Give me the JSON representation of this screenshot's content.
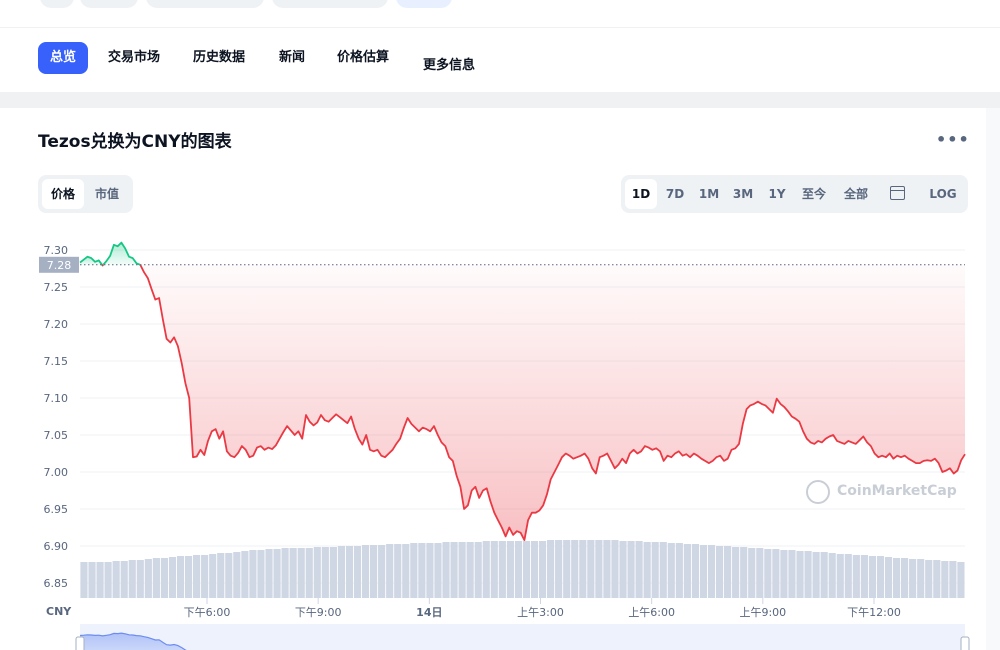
{
  "tabs": [
    {
      "label": "总览",
      "active": true
    },
    {
      "label": "交易市场",
      "active": false
    },
    {
      "label": "历史数据",
      "active": false
    },
    {
      "label": "新闻",
      "active": false
    },
    {
      "label": "价格估算",
      "active": false
    },
    {
      "label": "更多信息",
      "active": false
    }
  ],
  "chart_header": {
    "title": "Tezos兑换为CNY的图表",
    "more_icon": "more-horizontal-icon"
  },
  "metric_toggle": [
    {
      "label": "价格",
      "selected": true
    },
    {
      "label": "市值",
      "selected": false
    }
  ],
  "range_buttons": [
    {
      "label": "1D",
      "selected": true
    },
    {
      "label": "7D",
      "selected": false
    },
    {
      "label": "1M",
      "selected": false
    },
    {
      "label": "3M",
      "selected": false
    },
    {
      "label": "1Y",
      "selected": false
    },
    {
      "label": "至今",
      "selected": false
    },
    {
      "label": "全部",
      "selected": false
    }
  ],
  "calendar_icon": "calendar-icon",
  "log_label": "LOG",
  "watermark": "CoinMarketCap",
  "colors": {
    "accent": "#3861fb",
    "down": "#ea3943",
    "up": "#16c784",
    "volume": "#cfd6e4"
  },
  "chart_data": {
    "type": "line",
    "currency_label": "CNY",
    "y_ticks": [
      "7.30",
      "7.25",
      "7.20",
      "7.15",
      "7.10",
      "7.05",
      "7.00",
      "6.95",
      "6.90",
      "6.85"
    ],
    "ylim": [
      6.85,
      7.3
    ],
    "reference_price": 7.28,
    "reference_label": "7.28",
    "x_ticks": [
      "下午6:00",
      "下午9:00",
      "14日",
      "上午3:00",
      "上午6:00",
      "上午9:00",
      "下午12:00"
    ],
    "series": [
      {
        "values": [
          7.283,
          7.287,
          7.291,
          7.289,
          7.284,
          7.286,
          7.279,
          7.285,
          7.292,
          7.307,
          7.305,
          7.31,
          7.302,
          7.291,
          7.289,
          7.282,
          7.28,
          7.27,
          7.262,
          7.247,
          7.233,
          7.235,
          7.206,
          7.18,
          7.175,
          7.182,
          7.17,
          7.147,
          7.12,
          7.1,
          7.02,
          7.021,
          7.03,
          7.023,
          7.042,
          7.055,
          7.058,
          7.045,
          7.055,
          7.028,
          7.022,
          7.02,
          7.026,
          7.035,
          7.03,
          7.02,
          7.022,
          7.033,
          7.035,
          7.03,
          7.033,
          7.031,
          7.036,
          7.045,
          7.054,
          7.062,
          7.056,
          7.05,
          7.055,
          7.045,
          7.077,
          7.068,
          7.063,
          7.067,
          7.077,
          7.07,
          7.068,
          7.073,
          7.078,
          7.074,
          7.07,
          7.066,
          7.075,
          7.058,
          7.045,
          7.037,
          7.05,
          7.03,
          7.028,
          7.03,
          7.022,
          7.02,
          7.025,
          7.03,
          7.038,
          7.045,
          7.06,
          7.073,
          7.065,
          7.06,
          7.055,
          7.06,
          7.058,
          7.055,
          7.062,
          7.05,
          7.04,
          7.035,
          7.02,
          7.015,
          6.995,
          6.98,
          6.95,
          6.955,
          6.975,
          6.98,
          6.965,
          6.975,
          6.978,
          6.96,
          6.945,
          6.935,
          6.925,
          6.913,
          6.925,
          6.915,
          6.92,
          6.918,
          6.908,
          6.935,
          6.945,
          6.945,
          6.948,
          6.955,
          6.97,
          6.99,
          7.0,
          7.01,
          7.02,
          7.025,
          7.022,
          7.018,
          7.02,
          7.022,
          7.025,
          7.018,
          7.005,
          6.998,
          7.02,
          7.022,
          7.025,
          7.015,
          7.005,
          7.01,
          7.018,
          7.012,
          7.025,
          7.03,
          7.025,
          7.028,
          7.035,
          7.033,
          7.03,
          7.032,
          7.028,
          7.015,
          7.022,
          7.02,
          7.025,
          7.028,
          7.022,
          7.024,
          7.02,
          7.025,
          7.022,
          7.018,
          7.015,
          7.012,
          7.015,
          7.02,
          7.022,
          7.015,
          7.018,
          7.03,
          7.032,
          7.038,
          7.065,
          7.085,
          7.09,
          7.092,
          7.095,
          7.092,
          7.09,
          7.085,
          7.08,
          7.099,
          7.092,
          7.088,
          7.082,
          7.075,
          7.072,
          7.068,
          7.055,
          7.045,
          7.04,
          7.038,
          7.042,
          7.04,
          7.045,
          7.048,
          7.05,
          7.042,
          7.04,
          7.038,
          7.042,
          7.04,
          7.038,
          7.043,
          7.048,
          7.04,
          7.035,
          7.025,
          7.02,
          7.022,
          7.02,
          7.025,
          7.018,
          7.022,
          7.02,
          7.022,
          7.018,
          7.015,
          7.012,
          7.012,
          7.015,
          7.016,
          7.015,
          7.018,
          7.012,
          7.0,
          7.002,
          7.005,
          6.998,
          7.002,
          7.016,
          7.024
        ]
      }
    ],
    "volume": [
      0.36,
      0.36,
      0.36,
      0.36,
      0.37,
      0.37,
      0.38,
      0.38,
      0.39,
      0.4,
      0.4,
      0.41,
      0.42,
      0.42,
      0.43,
      0.43,
      0.44,
      0.45,
      0.45,
      0.46,
      0.47,
      0.48,
      0.48,
      0.49,
      0.49,
      0.5,
      0.5,
      0.5,
      0.5,
      0.51,
      0.51,
      0.51,
      0.52,
      0.52,
      0.52,
      0.53,
      0.53,
      0.53,
      0.54,
      0.54,
      0.54,
      0.55,
      0.55,
      0.55,
      0.55,
      0.56,
      0.56,
      0.56,
      0.56,
      0.56,
      0.57,
      0.57,
      0.57,
      0.57,
      0.57,
      0.57,
      0.57,
      0.57,
      0.58,
      0.58,
      0.58,
      0.58,
      0.58,
      0.58,
      0.58,
      0.58,
      0.58,
      0.57,
      0.57,
      0.57,
      0.56,
      0.56,
      0.56,
      0.55,
      0.55,
      0.54,
      0.54,
      0.53,
      0.53,
      0.52,
      0.52,
      0.51,
      0.51,
      0.5,
      0.5,
      0.49,
      0.49,
      0.48,
      0.48,
      0.47,
      0.47,
      0.46,
      0.46,
      0.45,
      0.44,
      0.44,
      0.43,
      0.43,
      0.42,
      0.42,
      0.41,
      0.4,
      0.4,
      0.39,
      0.39,
      0.38,
      0.38,
      0.37,
      0.37,
      0.36
    ]
  }
}
